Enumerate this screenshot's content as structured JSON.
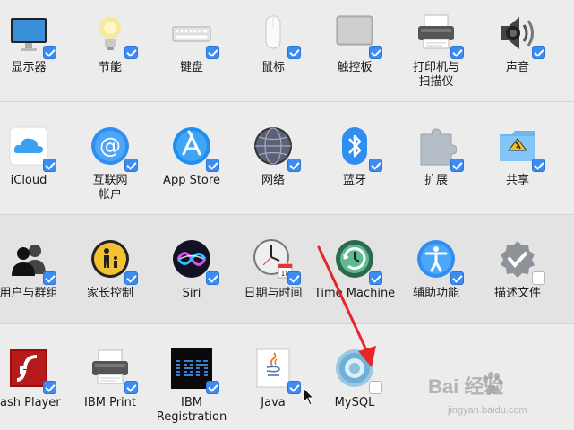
{
  "rows": [
    [
      {
        "id": "displays",
        "label": "显示器",
        "icon": "display-icon",
        "checked": true
      },
      {
        "id": "energy-saver",
        "label": "节能",
        "icon": "lightbulb-icon",
        "checked": true
      },
      {
        "id": "keyboard",
        "label": "键盘",
        "icon": "keyboard-icon",
        "checked": true
      },
      {
        "id": "mouse",
        "label": "鼠标",
        "icon": "mouse-icon",
        "checked": true
      },
      {
        "id": "trackpad",
        "label": "触控板",
        "icon": "trackpad-icon",
        "checked": true
      },
      {
        "id": "printers",
        "label": "打印机与\n扫描仪",
        "icon": "printer-icon",
        "checked": true
      },
      {
        "id": "sound",
        "label": "声音",
        "icon": "speaker-icon",
        "checked": true
      }
    ],
    [
      {
        "id": "icloud",
        "label": "iCloud",
        "icon": "cloud-icon",
        "checked": true
      },
      {
        "id": "internet-accounts",
        "label": "互联网\n帐户",
        "icon": "at-icon",
        "checked": true
      },
      {
        "id": "app-store",
        "label": "App Store",
        "icon": "app-store-icon",
        "checked": true
      },
      {
        "id": "network",
        "label": "网络",
        "icon": "globe-icon",
        "checked": true
      },
      {
        "id": "bluetooth",
        "label": "蓝牙",
        "icon": "bluetooth-icon",
        "checked": true
      },
      {
        "id": "extensions",
        "label": "扩展",
        "icon": "puzzle-icon",
        "checked": true
      },
      {
        "id": "sharing",
        "label": "共享",
        "icon": "sharing-folder-icon",
        "checked": true
      }
    ],
    [
      {
        "id": "users-groups",
        "label": "用户与群组",
        "icon": "users-icon",
        "checked": true
      },
      {
        "id": "parental-controls",
        "label": "家长控制",
        "icon": "parental-icon",
        "checked": true
      },
      {
        "id": "siri",
        "label": "Siri",
        "icon": "siri-icon",
        "checked": true
      },
      {
        "id": "date-time",
        "label": "日期与时间",
        "icon": "clock-icon",
        "checked": true
      },
      {
        "id": "time-machine",
        "label": "Time Machine",
        "icon": "time-machine-icon",
        "checked": true
      },
      {
        "id": "accessibility",
        "label": "辅助功能",
        "icon": "accessibility-icon",
        "checked": true
      },
      {
        "id": "profiles",
        "label": "描述文件",
        "icon": "badge-check-icon",
        "checked": false
      }
    ],
    [
      {
        "id": "flash-player",
        "label": "lash Player",
        "icon": "flash-icon",
        "checked": true
      },
      {
        "id": "ibm-print",
        "label": "IBM Print",
        "icon": "printer-icon",
        "checked": true
      },
      {
        "id": "ibm-registration",
        "label": "IBM Registration",
        "icon": "ibm-logo-icon",
        "checked": true
      },
      {
        "id": "java",
        "label": "Java",
        "icon": "java-icon",
        "checked": true
      },
      {
        "id": "mysql",
        "label": "MySQL",
        "icon": "mysql-icon",
        "checked": false
      }
    ]
  ],
  "watermark": {
    "main": "Bai 经验",
    "sub": "jingyan.baidu.com"
  },
  "colors": {
    "check_blue": "#3b8cf5",
    "annotation_red": "#e8262a"
  }
}
